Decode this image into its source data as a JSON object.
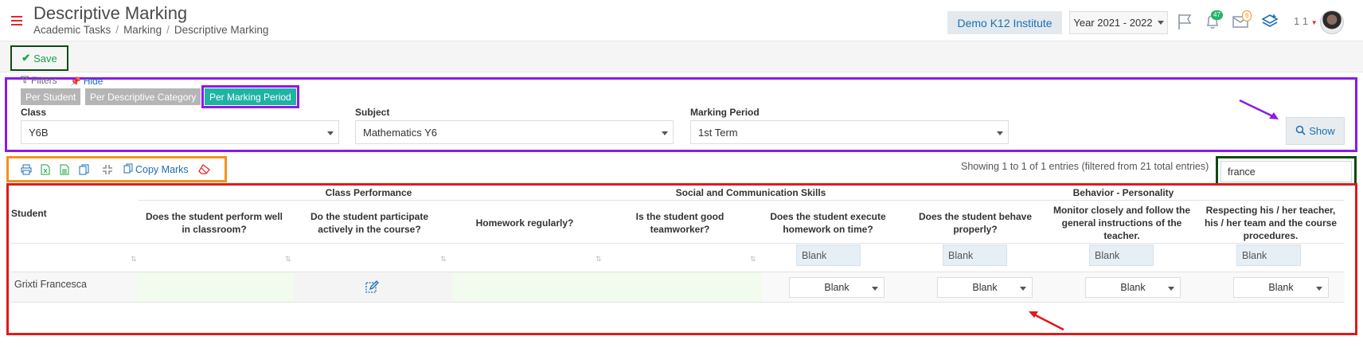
{
  "header": {
    "title": "Descriptive Marking",
    "breadcrumb": [
      "Academic Tasks",
      "Marking",
      "Descriptive Marking"
    ],
    "institute": "Demo K12 Institute",
    "year": "Year 2021 - 2022",
    "notifications_count": "47",
    "messages_count": "6",
    "user_number": "1 1"
  },
  "toolbar": {
    "save_label": "Save"
  },
  "filters": {
    "label": "Filters",
    "hide_label": "Hide",
    "modes": [
      "Per Student",
      "Per Descriptive Category",
      "Per Marking Period"
    ],
    "active_mode": "Per Marking Period",
    "fields": [
      {
        "label": "Class",
        "value": "Y6B"
      },
      {
        "label": "Subject",
        "value": "Mathematics Y6"
      },
      {
        "label": "Marking Period",
        "value": "1st Term"
      }
    ],
    "show_label": "Show"
  },
  "actions": {
    "copy_marks_label": "Copy Marks"
  },
  "search": {
    "value": "france"
  },
  "showing_text": "Showing 1 to 1 of 1 entries (filtered from 21 total entries)",
  "table": {
    "student_header": "Student",
    "groups": [
      "Class Performance",
      "Social and Communication Skills",
      "Behavior - Personality"
    ],
    "columns": [
      "Does the student perform well in classroom?",
      "Do the student participate actively in the course?",
      "Homework regularly?",
      "Is the student good teamworker?",
      "Does the student execute homework on time?",
      "Does the student behave properly?",
      "Monitor closely and follow the general instructions of the teacher.",
      "Respecting his / her teacher, his / her team and the course procedures."
    ],
    "filter_blank": "Blank",
    "rows": [
      {
        "student": "Grixti Francesca",
        "marks": [
          "",
          "",
          "",
          "",
          "Blank",
          "Blank",
          "Blank",
          "Blank"
        ]
      }
    ]
  },
  "colors": {
    "accent_teal": "#1fb3a3",
    "link_blue": "#1a6fb5",
    "save_green": "#18a34a",
    "annotation_purple": "#8b1aeb",
    "annotation_orange": "#f5921e",
    "annotation_red": "#e01a1a",
    "annotation_dark_green": "#0e4a12"
  }
}
